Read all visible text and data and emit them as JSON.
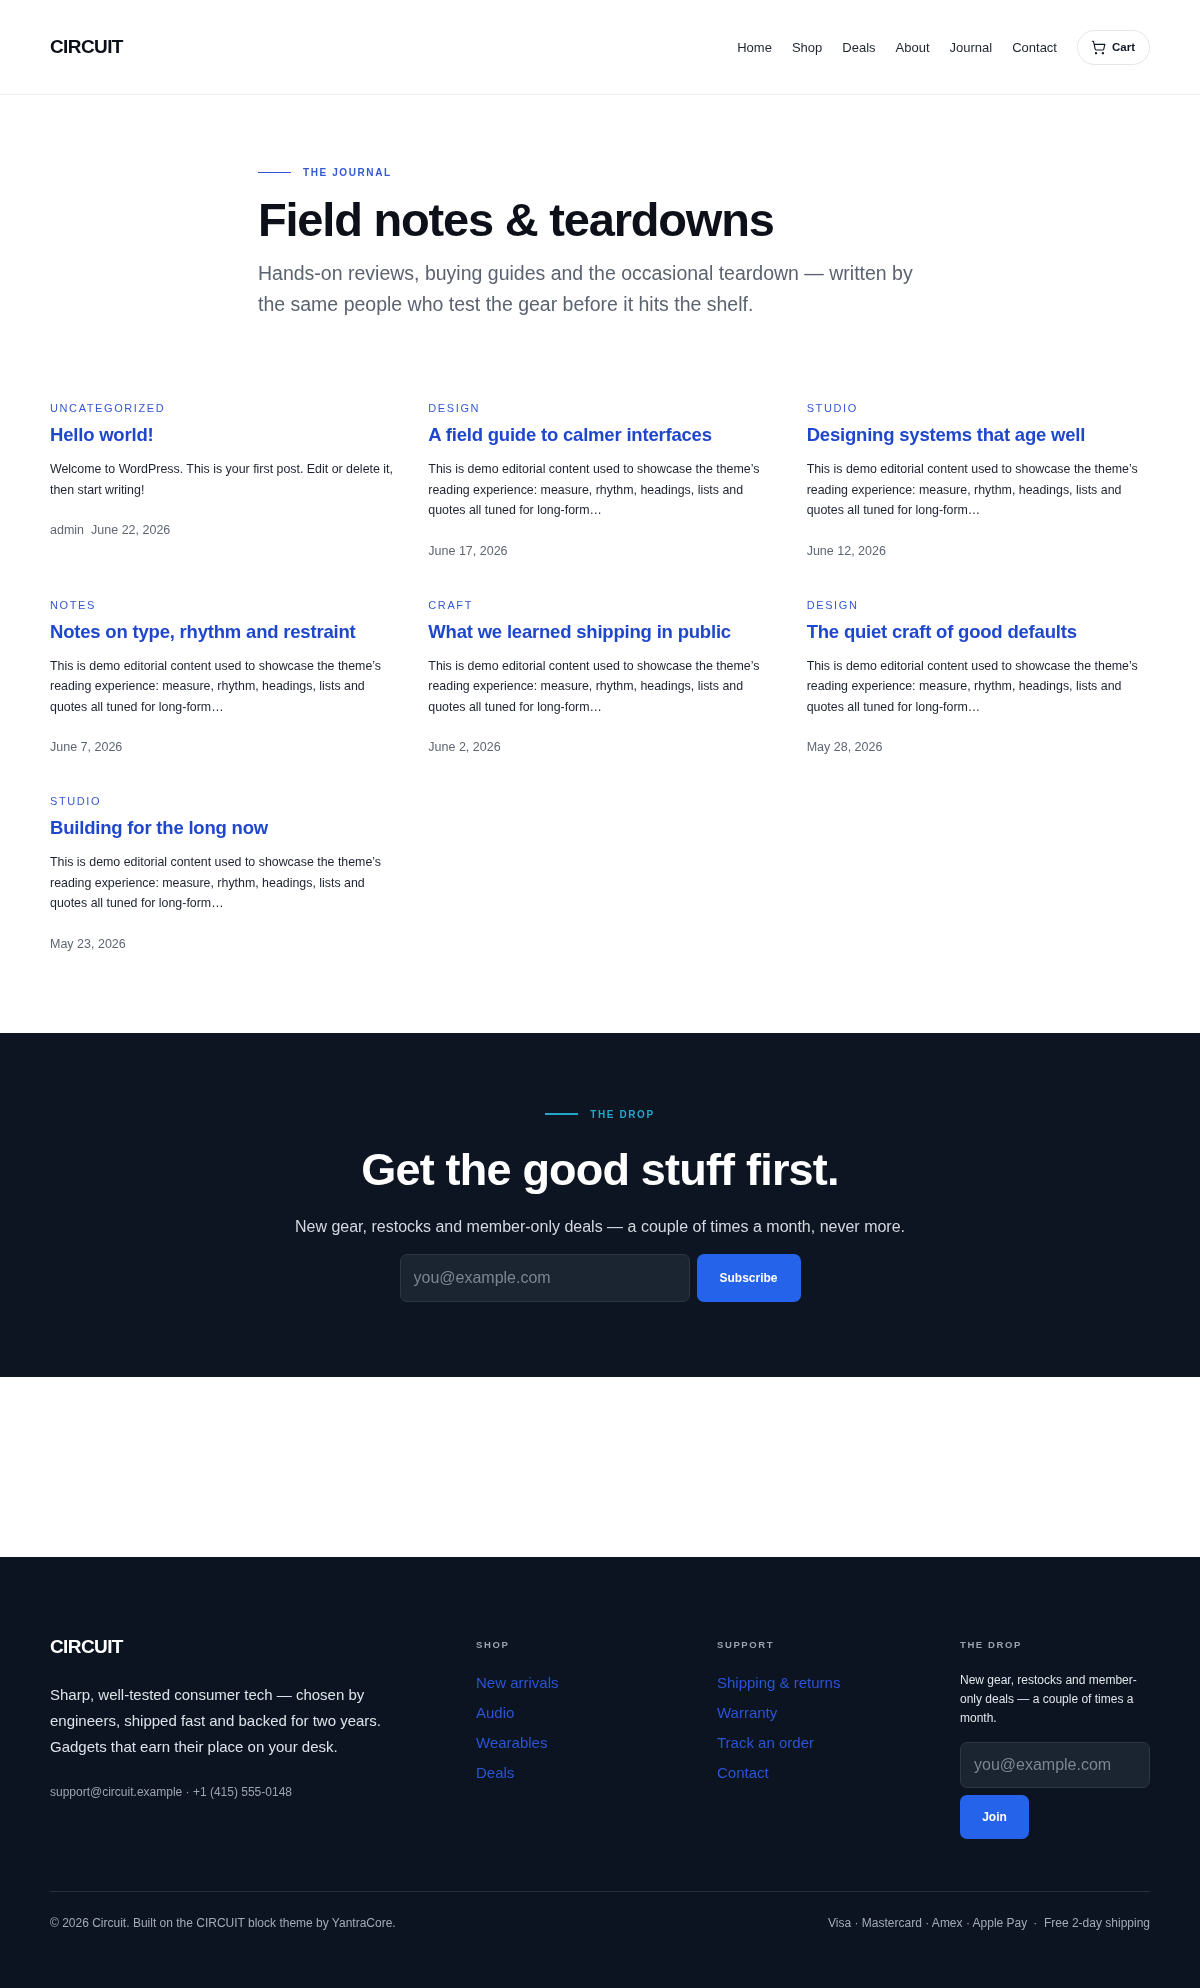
{
  "header": {
    "logo": "CIRCUIT",
    "nav": [
      {
        "label": "Home"
      },
      {
        "label": "Shop"
      },
      {
        "label": "Deals"
      },
      {
        "label": "About"
      },
      {
        "label": "Journal"
      },
      {
        "label": "Contact"
      }
    ],
    "cart": "Cart"
  },
  "hero": {
    "eyebrow": "THE JOURNAL",
    "title": "Field notes & teardowns",
    "subtitle": "Hands-on reviews, buying guides and the occasional teardown — written by the same people who test the gear before it hits the shelf."
  },
  "posts": [
    {
      "category": "UNCATEGORIZED",
      "title": "Hello world!",
      "excerpt": "Welcome to WordPress. This is your first post. Edit or delete it, then start writing!",
      "author": "admin",
      "date": "June 22, 2026"
    },
    {
      "category": "DESIGN",
      "title": "A field guide to calmer interfaces",
      "excerpt": "This is demo editorial content used to showcase the theme’s reading experience: measure, rhythm, headings, lists and quotes all tuned for long-form…",
      "date": "June 17, 2026"
    },
    {
      "category": "STUDIO",
      "title": "Designing systems that age well",
      "excerpt": "This is demo editorial content used to showcase the theme’s reading experience: measure, rhythm, headings, lists and quotes all tuned for long-form…",
      "date": "June 12, 2026"
    },
    {
      "category": "NOTES",
      "title": "Notes on type, rhythm and restraint",
      "excerpt": "This is demo editorial content used to showcase the theme’s reading experience: measure, rhythm, headings, lists and quotes all tuned for long-form…",
      "date": "June 7, 2026"
    },
    {
      "category": "CRAFT",
      "title": "What we learned shipping in public",
      "excerpt": "This is demo editorial content used to showcase the theme’s reading experience: measure, rhythm, headings, lists and quotes all tuned for long-form…",
      "date": "June 2, 2026"
    },
    {
      "category": "DESIGN",
      "title": "The quiet craft of good defaults",
      "excerpt": "This is demo editorial content used to showcase the theme’s reading experience: measure, rhythm, headings, lists and quotes all tuned for long-form…",
      "date": "May 28, 2026"
    },
    {
      "category": "STUDIO",
      "title": "Building for the long now",
      "excerpt": "This is demo editorial content used to showcase the theme’s reading experience: measure, rhythm, headings, lists and quotes all tuned for long-form…",
      "date": "May 23, 2026"
    }
  ],
  "newsletter": {
    "eyebrow": "THE DROP",
    "title": "Get the good stuff first.",
    "subtitle": "New gear, restocks and member-only deals — a couple of times a month, never more.",
    "email": {
      "placeholder": "you@example.com"
    },
    "button": "Subscribe"
  },
  "footer": {
    "logo": "CIRCUIT",
    "blurb": "Sharp, well-tested consumer tech — chosen by engineers, shipped fast and backed for two years. Gadgets that earn their place on your desk.",
    "contact": "support@circuit.example · +1 (415) 555-0148",
    "columns": [
      {
        "heading": "SHOP",
        "links": [
          "New arrivals",
          "Audio",
          "Wearables",
          "Deals"
        ]
      },
      {
        "heading": "SUPPORT",
        "links": [
          "Shipping & returns",
          "Warranty",
          "Track an order",
          "Contact"
        ]
      }
    ],
    "drop": {
      "heading": "THE DROP",
      "text": "New gear, restocks and member-only deals — a couple of times a month.",
      "email": {
        "placeholder": "you@example.com"
      },
      "button": "Join"
    },
    "copyright": "© 2026 Circuit. Built on the CIRCUIT block theme by YantraCore.",
    "payments": "Visa · Mastercard · Amex · Apple Pay",
    "shipping": "·  Free 2-day shipping"
  }
}
